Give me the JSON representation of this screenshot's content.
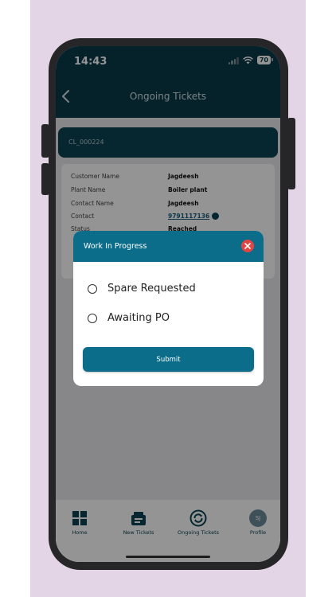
{
  "status_bar": {
    "time": "14:43",
    "battery": "70"
  },
  "header": {
    "title": "Ongoing Tickets"
  },
  "ticket": {
    "id": "CL_000224"
  },
  "details": [
    {
      "label": "Customer Name",
      "value": "Jagdeesh"
    },
    {
      "label": "Plant Name",
      "value": "Boiler plant"
    },
    {
      "label": "Contact Name",
      "value": "Jagdeesh"
    },
    {
      "label": "Contact",
      "value": "9791117136"
    },
    {
      "label": "Status",
      "value": "Reached"
    }
  ],
  "dialog": {
    "title": "Work In Progress",
    "options": [
      "Spare Requested",
      "Awaiting PO"
    ],
    "submit_label": "Submit"
  },
  "nav": [
    {
      "label": "Home",
      "icon": "home-grid-icon"
    },
    {
      "label": "New Tickets",
      "icon": "tickets-icon"
    },
    {
      "label": "Ongoing Tickets",
      "icon": "sync-icon"
    },
    {
      "label": "Profile",
      "icon": "avatar",
      "initials": "SJ"
    }
  ],
  "colors": {
    "header": "#0a3b4b",
    "accent": "#0b6d8a",
    "close": "#e24444"
  }
}
